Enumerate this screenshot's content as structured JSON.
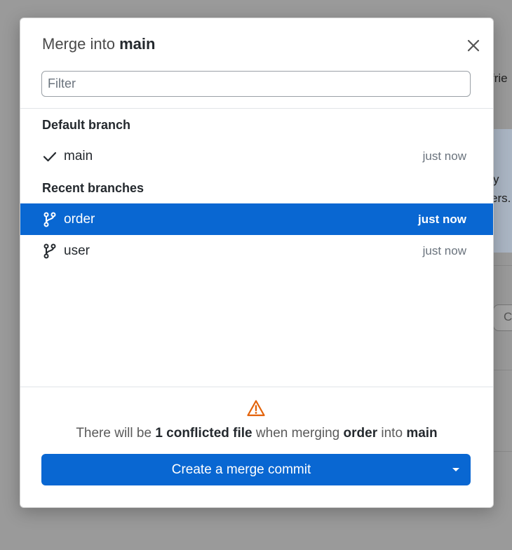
{
  "background": {
    "frag1": "frie",
    "frag2": "y",
    "frag3": "ers.",
    "frag4": "C"
  },
  "dialog": {
    "title_prefix": "Merge into",
    "title_branch": "main",
    "close_icon": "close-icon",
    "filter_placeholder": "Filter",
    "filter_value": ""
  },
  "groups": {
    "default": {
      "label": "Default branch"
    },
    "recent": {
      "label": "Recent branches"
    }
  },
  "branches": {
    "main": {
      "name": "main",
      "time": "just now",
      "icon": "check-icon"
    },
    "order": {
      "name": "order",
      "time": "just now",
      "icon": "branch-icon",
      "selected": true
    },
    "user": {
      "name": "user",
      "time": "just now",
      "icon": "branch-icon"
    }
  },
  "status": {
    "icon": "warning-icon",
    "part1": "There will be",
    "count_text": "1 conflicted file",
    "part2": "when merging",
    "source": "order",
    "part3": "into",
    "target": "main"
  },
  "merge_button": {
    "label": "Create a merge commit",
    "caret_icon": "caret-down-icon"
  },
  "colors": {
    "accent": "#0967d2",
    "warning": "#e36209",
    "overlay": "#9a9a9a"
  }
}
